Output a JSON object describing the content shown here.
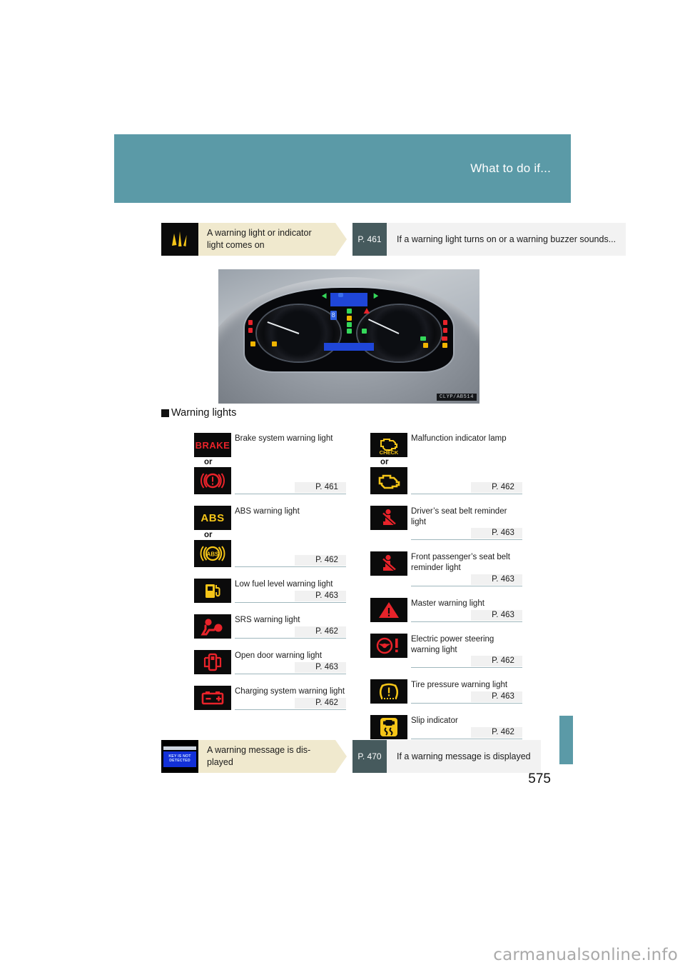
{
  "header": {
    "title": "What to do if..."
  },
  "flow_top": {
    "icon_name": "warning-burst-icon",
    "condition": "A warning light or indicator light comes on",
    "page_ref": "P. 461",
    "destination": "If a warning light turns on or a warning buzzer sounds..."
  },
  "flow_bottom": {
    "icon_name": "key-not-detected-display-icon",
    "icon_text_line1": "KEY IS NOT",
    "icon_text_line2": "DETECTED",
    "condition": "A warning message is dis-played",
    "page_ref": "P. 470",
    "destination": "If a warning message is displayed"
  },
  "cluster": {
    "caption_code": "CLYP/AB514",
    "digit": "8"
  },
  "section": {
    "heading": "Warning lights"
  },
  "warning_lights": {
    "left_column": [
      {
        "name": "Brake system warning light",
        "icon": "brake-text-icon",
        "icon_label": "BRAKE",
        "has_alt": true,
        "or_label": "or",
        "alt_icon": "brake-circle-exclamation-icon",
        "page": "P. 461"
      },
      {
        "name": "ABS warning light",
        "icon": "abs-text-icon",
        "icon_label": "ABS",
        "has_alt": true,
        "or_label": "or",
        "alt_icon": "abs-circle-icon",
        "page": "P. 462"
      },
      {
        "name": "Low fuel level warning light",
        "icon": "fuel-pump-icon",
        "has_alt": false,
        "page": "P. 463"
      },
      {
        "name": "SRS warning light",
        "icon": "srs-airbag-icon",
        "has_alt": false,
        "page": "P. 462"
      },
      {
        "name": "Open door warning light",
        "icon": "open-door-icon",
        "has_alt": false,
        "page": "P. 463"
      },
      {
        "name": "Charging system warning light",
        "icon": "battery-charging-icon",
        "has_alt": false,
        "page": "P. 462"
      }
    ],
    "right_column": [
      {
        "name": "Malfunction indicator lamp",
        "icon": "check-engine-check-icon",
        "icon_label": "CHECK",
        "has_alt": true,
        "or_label": "or",
        "alt_icon": "check-engine-icon",
        "page": "P. 462"
      },
      {
        "name": "Driver’s seat belt reminder light",
        "icon": "seat-belt-reminder-icon",
        "has_alt": false,
        "page": "P. 463"
      },
      {
        "name": "Front passenger’s seat belt reminder light",
        "icon": "seat-belt-reminder-icon",
        "has_alt": false,
        "page": "P. 463"
      },
      {
        "name": "Master warning light",
        "icon": "master-warning-triangle-icon",
        "has_alt": false,
        "page": "P. 463"
      },
      {
        "name": "Electric power steering warning light",
        "icon": "electric-power-steering-icon",
        "has_alt": false,
        "page": "P. 462"
      },
      {
        "name": "Tire pressure warning light",
        "icon": "tire-pressure-icon",
        "has_alt": false,
        "page": "P. 463"
      },
      {
        "name": "Slip indicator",
        "icon": "slip-indicator-icon",
        "has_alt": false,
        "page": "P. 462"
      }
    ]
  },
  "footer": {
    "page_number": "575",
    "watermark": "carmanualsonline.info"
  },
  "colors": {
    "teal": "#5b9aa7",
    "cream": "#f0e9ce",
    "slate": "#465a5d",
    "light_gray": "#f2f2f2",
    "warning_red": "#e8232a",
    "warning_yellow": "#f5c518"
  }
}
